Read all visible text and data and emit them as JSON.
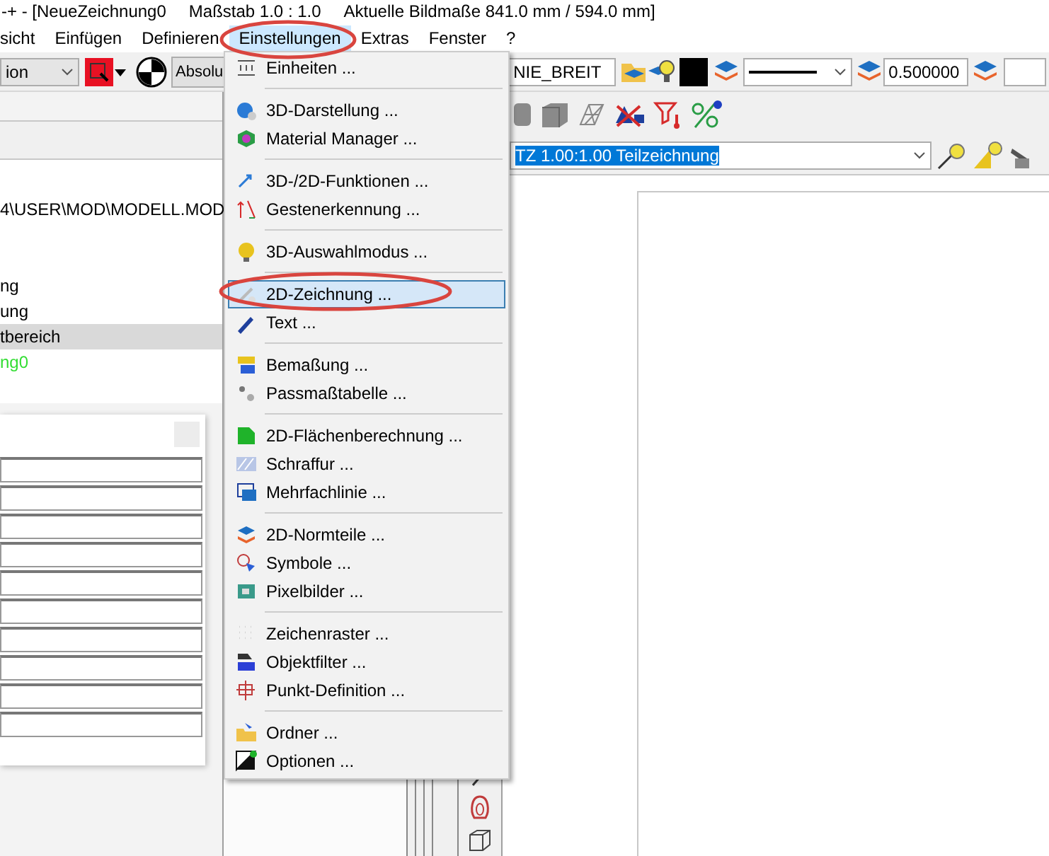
{
  "window": {
    "document": "-+ - [NeueZeichnung0",
    "scale": "Maßstab 1.0 : 1.0",
    "size": "Aktuelle Bildmaße 841.0 mm / 594.0 mm]"
  },
  "menu_bar": [
    {
      "label": "sicht",
      "selected": false
    },
    {
      "label": "Einfügen",
      "selected": false
    },
    {
      "label": "Definieren",
      "selected": false
    },
    {
      "label": "Einstellungen",
      "selected": true
    },
    {
      "label": "Extras",
      "selected": false
    },
    {
      "label": "Fenster",
      "selected": false
    },
    {
      "label": "?",
      "selected": false
    }
  ],
  "toolbar": {
    "mode_combo": "ion",
    "absolute_button": "Absolu",
    "layer_field": "NIE_BREIT",
    "width_field": "0.500000"
  },
  "drawing_combo": {
    "value": "TZ 1.00:1.00 Teilzeichnung",
    "highlighted": true
  },
  "tree": [
    {
      "label": "4\\USER\\MOD\\MODELL.MOD",
      "selected": false,
      "color": "#000000"
    },
    {
      "label": "ng",
      "selected": false,
      "color": "#000000"
    },
    {
      "label": "ung",
      "selected": false,
      "color": "#000000"
    },
    {
      "label": "tbereich",
      "selected": true,
      "color": "#000000"
    },
    {
      "label": "ng0",
      "selected": false,
      "color": "#33dd33"
    }
  ],
  "dialog": {
    "fields": [
      {
        "kind": "text"
      },
      {
        "kind": "text"
      },
      {
        "kind": "text"
      },
      {
        "kind": "text"
      },
      {
        "kind": "text"
      },
      {
        "kind": "text"
      },
      {
        "kind": "text"
      },
      {
        "kind": "text"
      },
      {
        "kind": "text"
      },
      {
        "kind": "text"
      }
    ]
  },
  "dropdown_menu": [
    [
      {
        "label": "Einheiten ...",
        "selected": false
      }
    ],
    [
      {
        "label": "3D-Darstellung ...",
        "selected": false
      },
      {
        "label": "Material Manager ...",
        "selected": false
      }
    ],
    [
      {
        "label": "3D-/2D-Funktionen ...",
        "selected": false
      },
      {
        "label": "Gestenerkennung ...",
        "selected": false
      }
    ],
    [
      {
        "label": "3D-Auswahlmodus ...",
        "selected": false
      }
    ],
    [
      {
        "label": "2D-Zeichnung ...",
        "selected": true
      },
      {
        "label": "Text ...",
        "selected": false
      }
    ],
    [
      {
        "label": "Bemaßung ...",
        "selected": false
      },
      {
        "label": "Passmaßtabelle ...",
        "selected": false
      }
    ],
    [
      {
        "label": "2D-Flächenberechnung ...",
        "selected": false
      },
      {
        "label": "Schraffur ...",
        "selected": false
      },
      {
        "label": "Mehrfachlinie ...",
        "selected": false
      }
    ],
    [
      {
        "label": "2D-Normteile ...",
        "selected": false
      },
      {
        "label": "Symbole ...",
        "selected": false
      },
      {
        "label": "Pixelbilder ...",
        "selected": false
      }
    ],
    [
      {
        "label": "Zeichenraster ...",
        "selected": false
      },
      {
        "label": "Objektfilter ...",
        "selected": false
      },
      {
        "label": "Punkt-Definition ...",
        "selected": false
      }
    ],
    [
      {
        "label": "Ordner ...",
        "selected": false
      },
      {
        "label": "Optionen ...",
        "selected": false
      }
    ]
  ]
}
